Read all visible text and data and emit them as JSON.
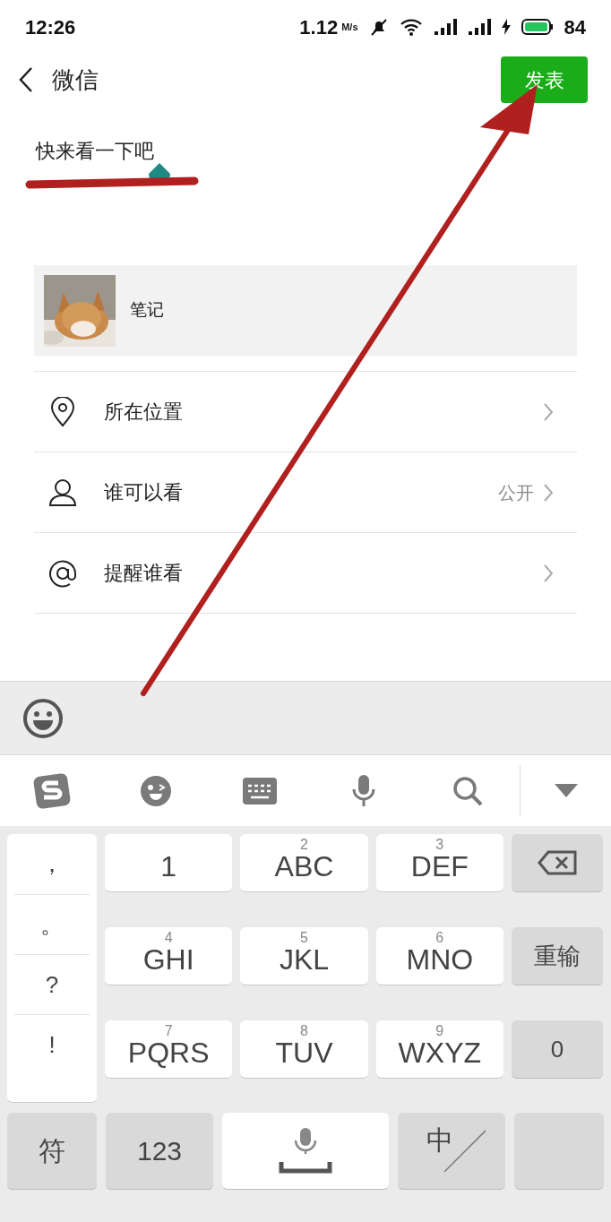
{
  "status_bar": {
    "time": "12:26",
    "speed": "1.12",
    "speed_unit": "M/s",
    "battery": "84"
  },
  "nav": {
    "back_label": "微信",
    "publish_button": "发表"
  },
  "post": {
    "text": "快来看一下吧"
  },
  "attachment": {
    "kind": "picture",
    "label": "笔记"
  },
  "options": [
    {
      "kind": "location",
      "label": "所在位置"
    },
    {
      "kind": "visibility",
      "label": "谁可以看",
      "value": "公开"
    },
    {
      "kind": "mention",
      "label": "提醒谁看"
    }
  ],
  "keyboard": {
    "symbols": [
      "，",
      "。",
      "?",
      "!"
    ],
    "key_rows": [
      [
        {
          "letters": "1"
        },
        {
          "digit": "2",
          "letters": "ABC"
        },
        {
          "digit": "3",
          "letters": "DEF"
        }
      ],
      [
        {
          "digit": "4",
          "letters": "GHI"
        },
        {
          "digit": "5",
          "letters": "JKL"
        },
        {
          "digit": "6",
          "letters": "MNO"
        }
      ],
      [
        {
          "digit": "7",
          "letters": "PQRS"
        },
        {
          "digit": "8",
          "letters": "TUV"
        },
        {
          "digit": "9",
          "letters": "WXYZ"
        }
      ]
    ],
    "side_keys": [
      {
        "kind": "delete"
      },
      {
        "kind": "text",
        "label": "重输"
      },
      {
        "kind": "text",
        "label": "0"
      }
    ],
    "bottom_keys": [
      {
        "kind": "text",
        "label": "符"
      },
      {
        "kind": "text",
        "label": "123"
      },
      {
        "kind": "space"
      },
      {
        "kind": "lang",
        "label": "中"
      },
      {
        "kind": "blank"
      }
    ]
  }
}
